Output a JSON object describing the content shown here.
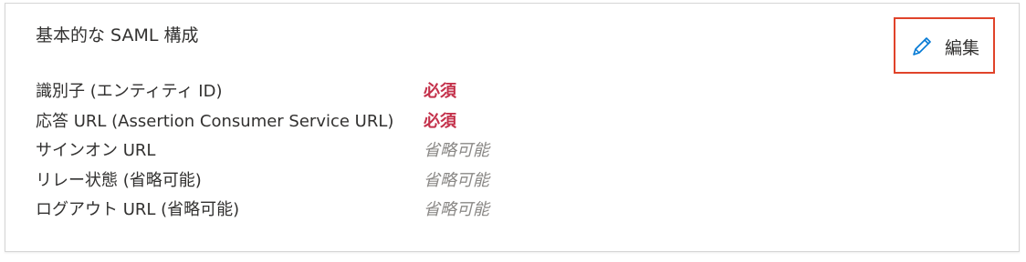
{
  "section": {
    "title": "基本的な SAML 構成",
    "edit_label": "編集"
  },
  "colors": {
    "required": "#c4314b",
    "optional": "#8a8886",
    "edit_highlight": "#e0432a",
    "edit_icon": "#0078d4"
  },
  "icons": {
    "edit": "pencil-icon"
  },
  "rows": [
    {
      "label": "識別子 (エンティティ ID)",
      "value": "必須",
      "status": "required"
    },
    {
      "label": "応答 URL (Assertion Consumer Service URL)",
      "value": "必須",
      "status": "required"
    },
    {
      "label": "サインオン URL",
      "value": "省略可能",
      "status": "optional"
    },
    {
      "label": "リレー状態 (省略可能)",
      "value": "省略可能",
      "status": "optional"
    },
    {
      "label": "ログアウト URL (省略可能)",
      "value": "省略可能",
      "status": "optional"
    }
  ]
}
